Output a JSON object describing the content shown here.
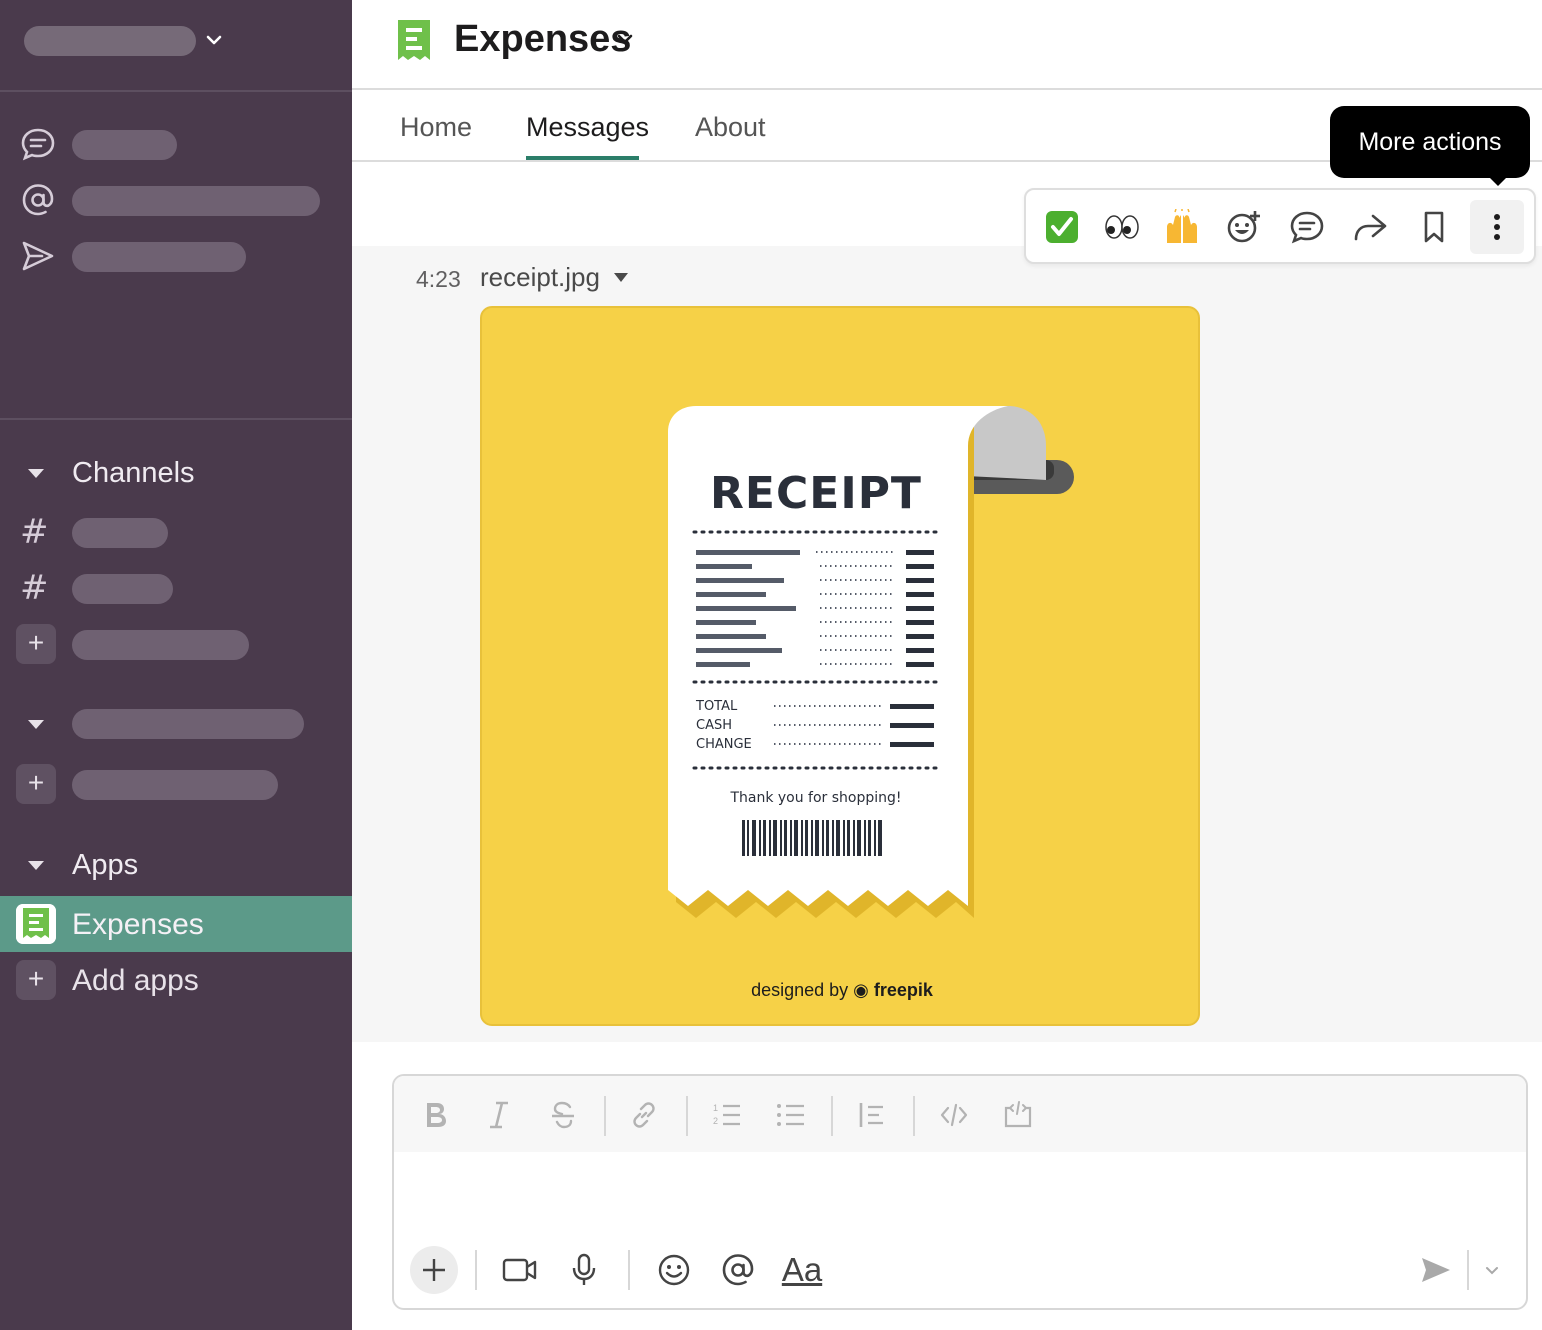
{
  "app": {
    "title": "Expenses"
  },
  "sidebar": {
    "sections": {
      "channels": {
        "label": "Channels"
      },
      "apps": {
        "label": "Apps"
      }
    },
    "apps": [
      {
        "label": "Expenses",
        "active": true
      },
      {
        "label": "Add apps"
      }
    ]
  },
  "tabs": [
    {
      "label": "Home"
    },
    {
      "label": "Messages",
      "active": true
    },
    {
      "label": "About"
    }
  ],
  "message": {
    "time": "4:23",
    "filename": "receipt.jpg",
    "image": {
      "heading": "RECEIPT",
      "totals": [
        "TOTAL",
        "CASH",
        "CHANGE"
      ],
      "thanks": "Thank you for shopping!",
      "credit_prefix": "designed by",
      "credit_brand": "freepik"
    }
  },
  "message_actions": {
    "tooltip": "More actions",
    "items": [
      {
        "icon": "check-mark-emoji",
        "glyph": "✅"
      },
      {
        "icon": "eyes-emoji",
        "glyph": "👀"
      },
      {
        "icon": "raised-hands-emoji",
        "glyph": "🙌"
      },
      {
        "icon": "add-reaction-icon"
      },
      {
        "icon": "reply-thread-icon"
      },
      {
        "icon": "share-icon"
      },
      {
        "icon": "bookmark-icon"
      },
      {
        "icon": "more-vertical-icon"
      }
    ]
  },
  "composer": {
    "format_buttons": [
      "bold-icon",
      "italic-icon",
      "strikethrough-icon",
      "link-icon",
      "ordered-list-icon",
      "bullet-list-icon",
      "blockquote-icon",
      "code-icon",
      "code-block-icon"
    ],
    "text_format_label": "Aa"
  },
  "colors": {
    "sidebar_bg": "#4a3a4c",
    "active_item": "#5c9a89",
    "tab_accent": "#2b7e69",
    "image_bg": "#f6d147",
    "app_icon_green": "#6fc04a"
  }
}
